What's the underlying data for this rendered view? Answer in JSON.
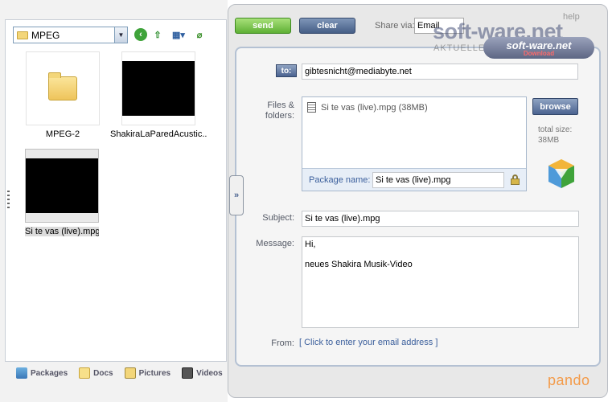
{
  "browser": {
    "current_folder": "MPEG",
    "items": [
      {
        "label": "MPEG-2",
        "type": "folder"
      },
      {
        "label": "ShakiraLaParedAcustic...",
        "type": "video"
      },
      {
        "label": "Si te vas (live).mpg",
        "type": "video",
        "selected": true
      }
    ],
    "tabs": [
      {
        "label": "Packages"
      },
      {
        "label": "Docs"
      },
      {
        "label": "Pictures"
      },
      {
        "label": "Videos"
      }
    ]
  },
  "send": {
    "send_label": "send",
    "clear_label": "clear",
    "share_via_label": "Share via:",
    "share_via_value": "Email",
    "help_label": "help",
    "to_label": "to:",
    "to_value": "gibtesnicht@mediabyte.net",
    "files_label": "Files & folders:",
    "file_entry": "Si te vas (live).mpg (38MB)",
    "package_name_label": "Package name:",
    "package_name_value": "Si te vas (live).mpg",
    "browse_label": "browse",
    "total_size_label": "total size:",
    "total_size_value": "38MB",
    "subject_label": "Subject:",
    "subject_value": "Si te vas (live).mpg",
    "message_label": "Message:",
    "message_line1": "Hi,",
    "message_line2": "neues Shakira Musik-Video",
    "from_label": "From:",
    "from_link": "[ Click to enter your email address ]",
    "brand": "pando"
  },
  "watermark": {
    "main": "soft-ware.net",
    "sub": "AKTUELLE SOFTWARE",
    "badge_main": "soft-ware.net",
    "badge_sub": "Download"
  },
  "colors": {
    "send_green": "#5fb035",
    "clear_blue": "#455e86",
    "link_blue": "#3b5f9c",
    "brand_orange": "#f39b4a"
  }
}
